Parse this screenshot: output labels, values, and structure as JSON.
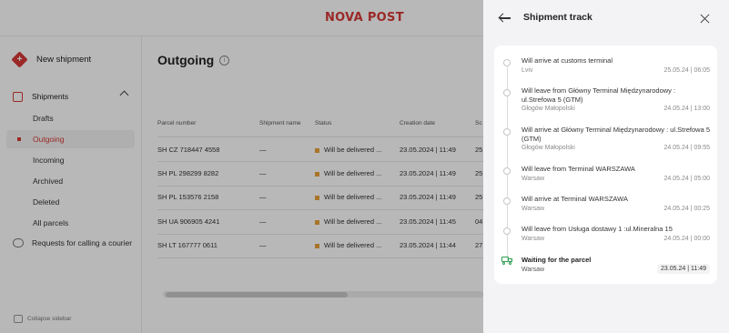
{
  "app": {
    "logo": "NOVA POST"
  },
  "sidebar": {
    "new_shipment": "New shipment",
    "shipments_label": "Shipments",
    "items": [
      "Drafts",
      "Outgoing",
      "Incoming",
      "Archived",
      "Deleted",
      "All parcels"
    ],
    "active_item": "Outgoing",
    "courier": "Requests for calling a courier",
    "collapse": "Collapse sidebar"
  },
  "main": {
    "title": "Outgoing",
    "columns": [
      "Parcel number",
      "Shipment name",
      "Status",
      "Creation date",
      "Sc"
    ],
    "rows": [
      {
        "number": "SH CZ 718447 4558",
        "name": "—",
        "status": "Will be delivered ...",
        "date": "23.05.2024 | 11:49",
        "extra": "25"
      },
      {
        "number": "SH PL 298299 8282",
        "name": "—",
        "status": "Will be delivered ...",
        "date": "23.05.2024 | 11:49",
        "extra": "25"
      },
      {
        "number": "SH PL 153576 2158",
        "name": "—",
        "status": "Will be delivered ...",
        "date": "23.05.2024 | 11:49",
        "extra": "25"
      },
      {
        "number": "SH UA 906905 4241",
        "name": "—",
        "status": "Will be delivered ...",
        "date": "23.05.2024 | 11:45",
        "extra": "04"
      },
      {
        "number": "SH LT 167777 0611",
        "name": "—",
        "status": "Will be delivered ...",
        "date": "23.05.2024 | 11:44",
        "extra": "27"
      }
    ],
    "status_color": "#e9a23b"
  },
  "drawer": {
    "title": "Shipment track",
    "events": [
      {
        "title": "Will arrive at customs terminal",
        "location": "Lviv",
        "datetime": "25.05.24 | 06:05"
      },
      {
        "title": "Will leave from Główny Terminal Międzynarodowy : ul.Strefowa 5 (GTM)",
        "location": "Głogów Małopolski",
        "datetime": "24.05.24 | 13:00"
      },
      {
        "title": "Will arrive at Główny Terminal Międzynarodowy : ul.Strefowa 5 (GTM)",
        "location": "Głogów Małopolski",
        "datetime": "24.05.24 | 09:55"
      },
      {
        "title": "Will leave from Terminal WARSZAWA",
        "location": "Warsaw",
        "datetime": "24.05.24 | 05:00"
      },
      {
        "title": "Will arrive at Terminal WARSZAWA",
        "location": "Warsaw",
        "datetime": "24.05.24 | 00:25"
      },
      {
        "title": "Will leave from Usługa dostawy 1 :ul.Mineralna 15",
        "location": "Warsaw",
        "datetime": "24.05.24 | 00:00"
      },
      {
        "title": "Waiting for the parcel",
        "location": "Warsaw",
        "datetime": "23.05.24 | 11:49"
      }
    ],
    "current_icon": "truck-icon",
    "current_color": "#2e9e52"
  },
  "colors": {
    "brand": "#d63a37",
    "accent_status": "#e9a23b",
    "current": "#2e9e52"
  }
}
